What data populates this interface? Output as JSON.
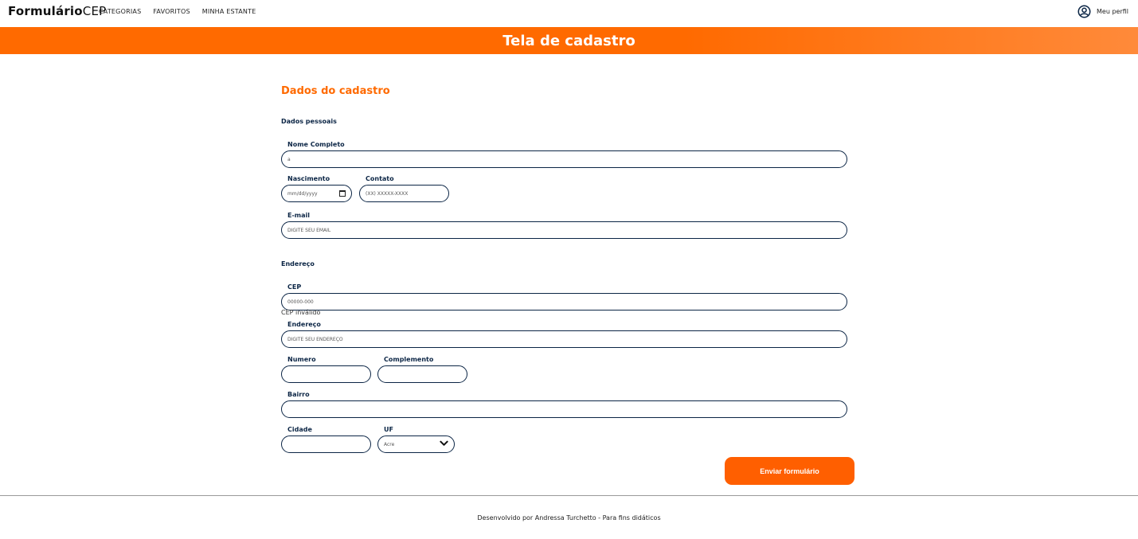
{
  "header": {
    "brand_bold": "Formulário",
    "brand_regular": "CEP",
    "nav": [
      "CATEGORIAS",
      "FAVORITOS",
      "MINHA ESTANTE"
    ],
    "profile_label": "Meu perfil",
    "profile_icon": "user-circle-icon"
  },
  "banner": {
    "title": "Tela de cadastro"
  },
  "form": {
    "section_title": "Dados do cadastro",
    "personal_title": "Dados pessoais",
    "nome_label": "Nome Completo",
    "nome_value": "a",
    "nascimento_label": "Nascimento",
    "nascimento_placeholder": "mm/dd/yyyy",
    "contato_label": "Contato",
    "contato_placeholder": "(XX) XXXXX-XXXX",
    "email_label": "E-mail",
    "email_placeholder": "DIGITE SEU EMAIL",
    "address_title": "Endereço",
    "cep_label": "CEP",
    "cep_placeholder": "00000-000",
    "cep_error": "CEP inválido",
    "endereco_label": "Endereço",
    "endereco_placeholder": "DIGITE SEU ENDEREÇO",
    "numero_label": "Numero",
    "complemento_label": "Complemento",
    "bairro_label": "Bairro",
    "cidade_label": "Cidade",
    "uf_label": "UF",
    "uf_selected": "Acre",
    "submit_label": "Enviar formulário"
  },
  "footer": {
    "text": "Desenvolvido por Andressa Turchetto - Para fins didáticos"
  },
  "colors": {
    "accent": "#ff6a00",
    "ink": "#0b2545"
  }
}
